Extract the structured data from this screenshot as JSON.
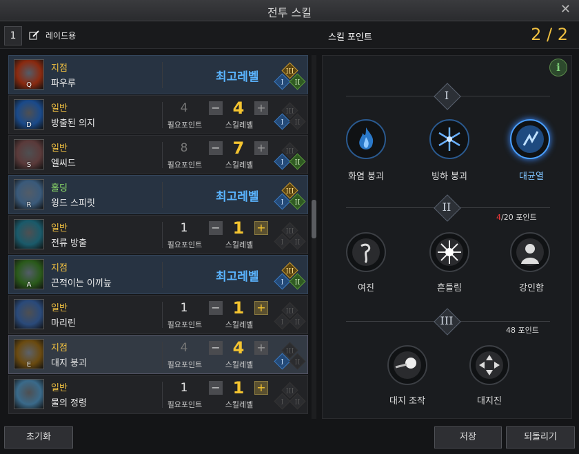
{
  "window": {
    "title": "전투 스킬"
  },
  "toolbar": {
    "preset_number": "1",
    "preset_name": "레이드용",
    "skill_point_title": "스킬 포인트",
    "skill_point_count": "2 / 2"
  },
  "skills": [
    {
      "type": "지점",
      "type_color": "#f0c040",
      "name": "파우루",
      "key": "Q",
      "state": "max",
      "max_label": "최고레벨",
      "tripod_active": [
        true,
        true,
        true
      ]
    },
    {
      "type": "일반",
      "type_color": "#f0c040",
      "name": "방출된 의지",
      "key": "D",
      "state": "lvl",
      "req": "4",
      "req_label": "필요포인트",
      "lvl": "4",
      "lvl_label": "스킬레벨",
      "plus_active": false,
      "tripod_active": [
        true,
        false,
        false
      ]
    },
    {
      "type": "일반",
      "type_color": "#f0c040",
      "name": "엘씨드",
      "key": "S",
      "state": "lvl",
      "req": "8",
      "req_label": "필요포인트",
      "lvl": "7",
      "lvl_label": "스킬레벨",
      "plus_active": false,
      "tripod_active": [
        true,
        true,
        false
      ]
    },
    {
      "type": "홀딩",
      "type_color": "#8fe06a",
      "name": "윙드 스피릿",
      "key": "R",
      "state": "max",
      "max_label": "최고레벨",
      "tripod_active": [
        true,
        true,
        true
      ]
    },
    {
      "type": "일반",
      "type_color": "#f0c040",
      "name": "전류 방출",
      "key": "",
      "state": "lvl",
      "req": "1",
      "req_label": "필요포인트",
      "lvl": "1",
      "lvl_label": "스킬레벨",
      "plus_active": true,
      "tripod_active": [
        false,
        false,
        false
      ]
    },
    {
      "type": "지점",
      "type_color": "#f0c040",
      "name": "끈적이는 이끼늪",
      "key": "A",
      "state": "max",
      "max_label": "최고레벨",
      "tripod_active": [
        true,
        true,
        true
      ]
    },
    {
      "type": "일반",
      "type_color": "#f0c040",
      "name": "마리린",
      "key": "",
      "state": "lvl",
      "req": "1",
      "req_label": "필요포인트",
      "lvl": "1",
      "lvl_label": "스킬레벨",
      "plus_active": true,
      "tripod_active": [
        false,
        false,
        false
      ]
    },
    {
      "type": "지점",
      "type_color": "#f0c040",
      "name": "대지 붕괴",
      "key": "E",
      "state": "lvl",
      "req": "4",
      "req_label": "필요포인트",
      "lvl": "4",
      "lvl_label": "스킬레벨",
      "plus_active": false,
      "selected": true,
      "tripod_active": [
        true,
        false,
        false
      ]
    },
    {
      "type": "일반",
      "type_color": "#f0c040",
      "name": "물의 정령",
      "key": "",
      "state": "lvl",
      "req": "1",
      "req_label": "필요포인트",
      "lvl": "1",
      "lvl_label": "스킬레벨",
      "plus_active": true,
      "tripod_active": [
        false,
        false,
        false
      ]
    }
  ],
  "tripod_numerals": [
    "I",
    "II",
    "III"
  ],
  "awakening": {
    "tier1": {
      "numeral": "I",
      "nodes": [
        {
          "label": "화염 붕괴",
          "icon": "flame-icon"
        },
        {
          "label": "빙하 붕괴",
          "icon": "snowflake-icon"
        },
        {
          "label": "대균열",
          "icon": "crack-icon",
          "highlight": true
        }
      ]
    },
    "tier2": {
      "numeral": "II",
      "points_current": "4",
      "points_rest": "/20 포인트",
      "nodes": [
        {
          "label": "여진",
          "icon": "aftershock-icon"
        },
        {
          "label": "흔들림",
          "icon": "burst-icon"
        },
        {
          "label": "강인함",
          "icon": "toughness-icon"
        }
      ]
    },
    "tier3": {
      "numeral": "III",
      "points": "48 포인트",
      "nodes": [
        {
          "label": "대지 조작",
          "icon": "earth-control-icon"
        },
        {
          "label": "대지진",
          "icon": "earthquake-icon"
        }
      ]
    }
  },
  "footer": {
    "reset_label": "초기화",
    "save_label": "저장",
    "revert_label": "되돌리기"
  }
}
